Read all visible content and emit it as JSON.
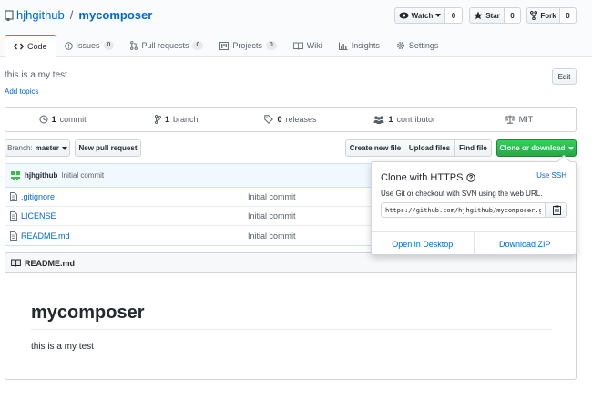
{
  "repo": {
    "owner": "hjhgithub",
    "separator": "/",
    "name": "mycomposer"
  },
  "actions": [
    {
      "label": "Watch",
      "count": "0"
    },
    {
      "label": "Star",
      "count": "0"
    },
    {
      "label": "Fork",
      "count": "0"
    }
  ],
  "tabs": [
    {
      "label": "Code"
    },
    {
      "label": "Issues",
      "count": "0"
    },
    {
      "label": "Pull requests",
      "count": "0"
    },
    {
      "label": "Projects",
      "count": "0"
    },
    {
      "label": "Wiki"
    },
    {
      "label": "Insights"
    },
    {
      "label": "Settings"
    }
  ],
  "description": "this is a my test",
  "edit_label": "Edit",
  "add_topics": "Add topics",
  "summary": {
    "commits": {
      "num": "1",
      "label": "commit"
    },
    "branches": {
      "num": "1",
      "label": "branch"
    },
    "releases": {
      "num": "0",
      "label": "releases"
    },
    "contributors": {
      "num": "1",
      "label": "contributor"
    },
    "license": "MIT"
  },
  "branch": {
    "prefix": "Branch:",
    "name": "master"
  },
  "toolbar": {
    "new_pr": "New pull request",
    "create_file": "Create new file",
    "upload": "Upload files",
    "find": "Find file",
    "clone": "Clone or download"
  },
  "latest_commit": {
    "author": "hjhgithub",
    "message": "Initial commit"
  },
  "files": [
    {
      "name": ".gitignore",
      "message": "Initial commit"
    },
    {
      "name": "LICENSE",
      "message": "Initial commit"
    },
    {
      "name": "README.md",
      "message": "Initial commit"
    }
  ],
  "readme": {
    "header": "README.md",
    "heading": "mycomposer",
    "body": "this is a my test"
  },
  "clone": {
    "title": "Clone with HTTPS",
    "use_ssh": "Use SSH",
    "desc": "Use Git or checkout with SVN using the web URL.",
    "url": "https://github.com/hjhgithub/mycomposer.git",
    "open_desktop": "Open in Desktop",
    "download_zip": "Download ZIP"
  },
  "colors": {
    "link": "#0366d6",
    "green": "#28a745",
    "tab_accent": "#e36209"
  }
}
